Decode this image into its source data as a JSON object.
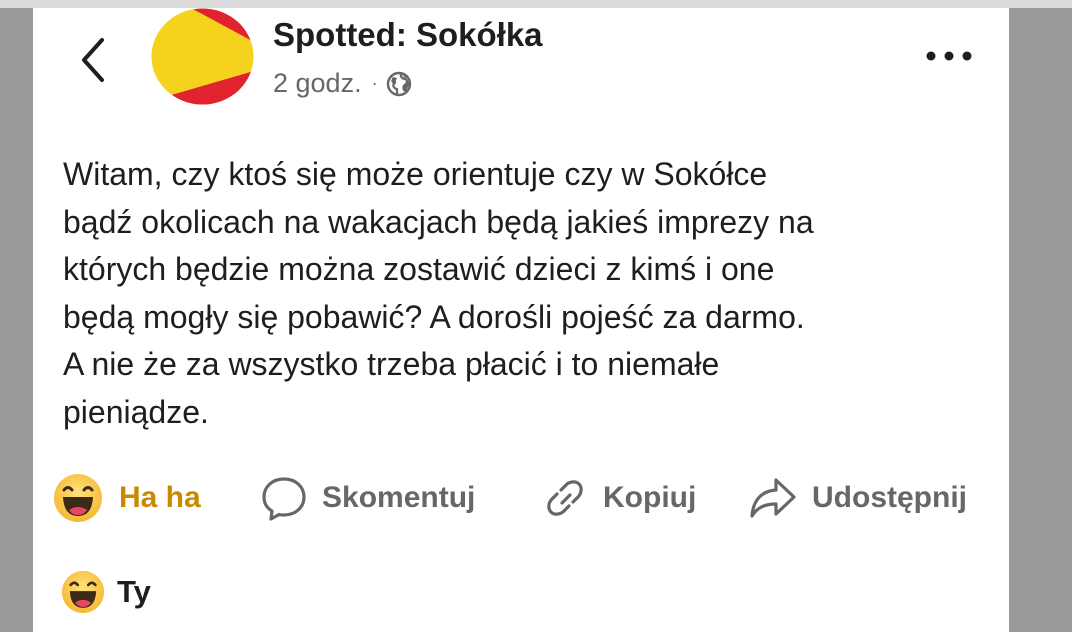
{
  "post": {
    "page_name": "Spotted: Sokółka",
    "time": "2 godz.",
    "separator": "·",
    "privacy_icon": "globe-icon",
    "text_lines": [
      "Witam, czy ktoś się może orientuje czy w Sokółce",
      "bądź okolicach na wakacjach będą jakieś imprezy na",
      "których będzie można zostawić dzieci z kimś i one",
      "będą mogły się pobawić? A dorośli pojeść za darmo.",
      "A nie że za wszystko trzeba płacić i to niemałe",
      "pieniądze."
    ]
  },
  "actions": {
    "reaction_label": "Ha ha",
    "comment_label": "Skomentuj",
    "copy_label": "Kopiuj",
    "share_label": "Udostępnij"
  },
  "reactions_summary": {
    "label": "Ty"
  },
  "colors": {
    "reaction_accent": "#c98a00",
    "avatar_red": "#e0232f",
    "avatar_yellow": "#f5d21e",
    "muted_text": "#65676b"
  }
}
